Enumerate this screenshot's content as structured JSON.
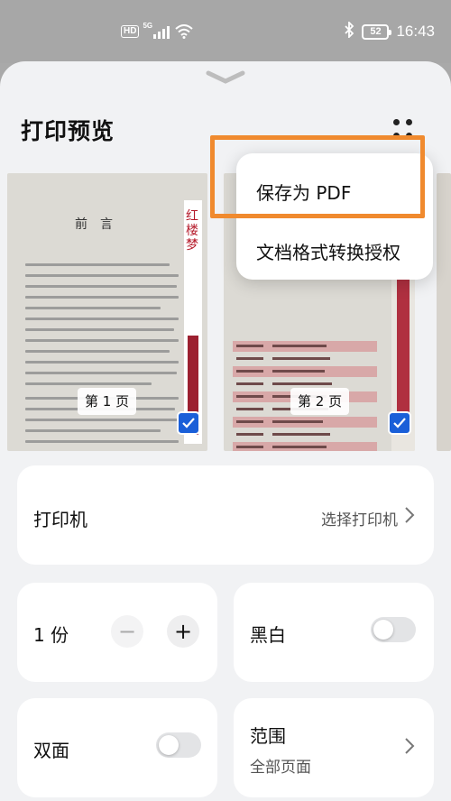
{
  "status_bar": {
    "hd": "HD",
    "network": "5G",
    "battery": "52",
    "time": "16:43"
  },
  "header": {
    "title": "打印预览"
  },
  "menu": {
    "items": [
      "保存为 PDF",
      "文档格式转换授权"
    ]
  },
  "highlight_color": "#f08a2e",
  "previews": [
    {
      "label": "第 1 页",
      "doc_heading": "前言",
      "side_text": "红楼梦"
    },
    {
      "label": "第 2 页"
    }
  ],
  "settings": {
    "printer": {
      "label": "打印机",
      "value": "选择打印机"
    },
    "copies": {
      "count_label": "1 份",
      "minus": "−",
      "plus": "+"
    },
    "bw": {
      "label": "黑白"
    },
    "duplex": {
      "label": "双面"
    },
    "range": {
      "label": "范围",
      "value": "全部页面"
    }
  },
  "colors": {
    "accent": "#1a5fd8",
    "sheet_bg": "#f1f2f4"
  }
}
